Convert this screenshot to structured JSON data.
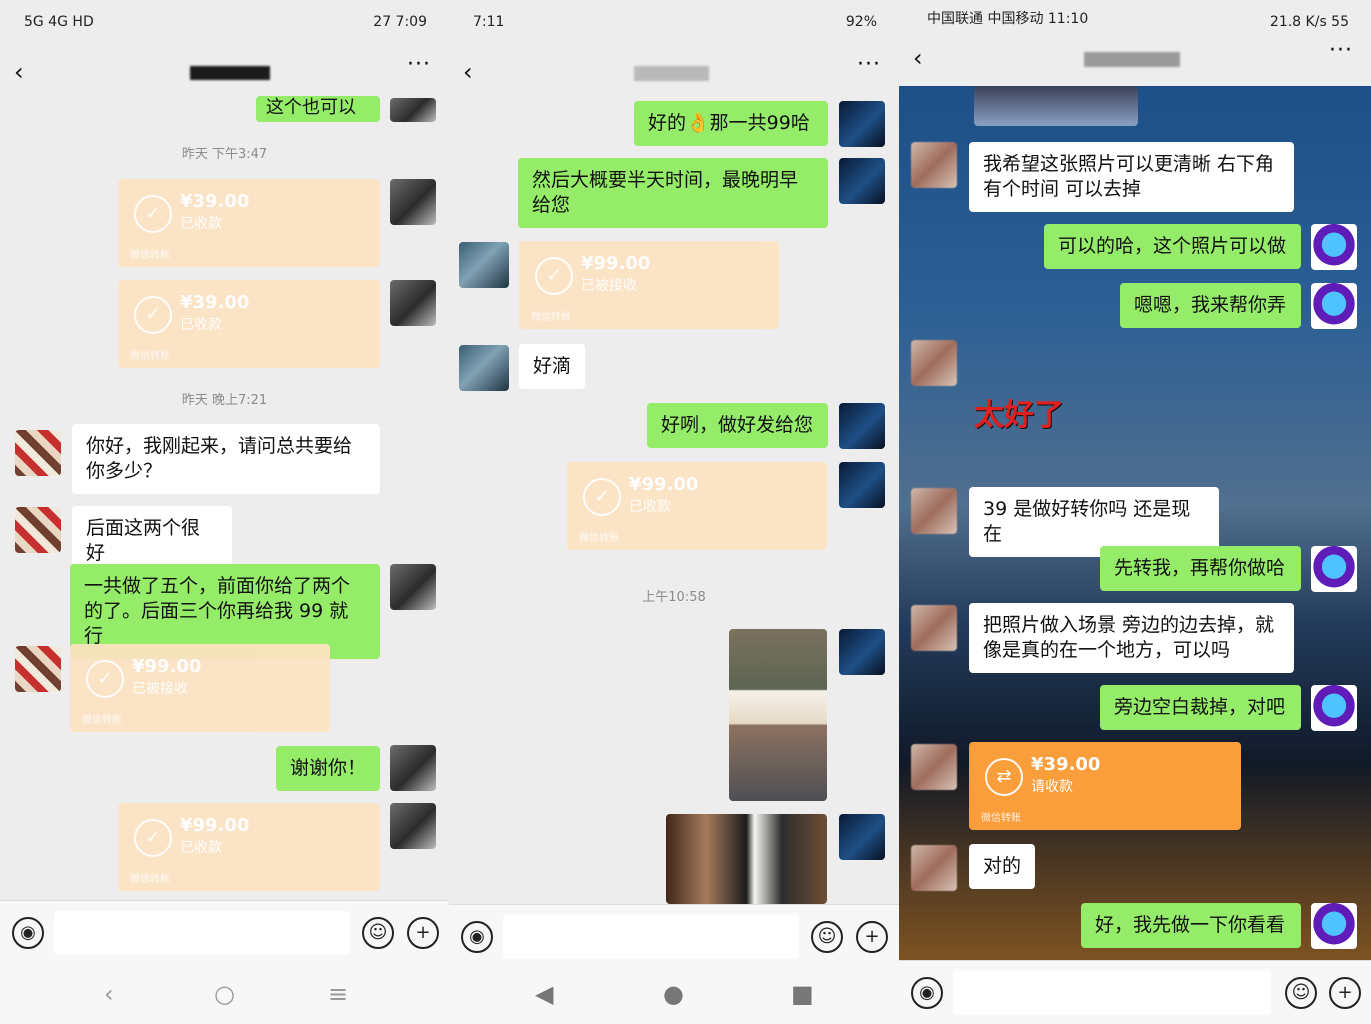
{
  "panels": {
    "p1": {
      "status": {
        "left": "5G 4G HD",
        "right": "27 7:09"
      },
      "timestamps": [
        "昨天 下午3:47",
        "昨天 晚上7:21"
      ],
      "top_partial_msg": "这个也可以",
      "payments": [
        {
          "amount": "¥39.00",
          "status": "已收款",
          "source": "微信转账"
        },
        {
          "amount": "¥39.00",
          "status": "已收款",
          "source": "微信转账"
        },
        {
          "amount": "¥99.00",
          "status": "已被接收",
          "source": "微信转账"
        },
        {
          "amount": "¥99.00",
          "status": "已收款",
          "source": "微信转账"
        }
      ],
      "messages": [
        {
          "text": "你好，我刚起来，请问总共要给你多少？",
          "side": "left"
        },
        {
          "text": "后面这两个很好",
          "side": "left"
        },
        {
          "text": "一共做了五个，前面你给了两个的了。后面三个你再给我 99 就行",
          "side": "right"
        },
        {
          "text": "谢谢你！",
          "side": "right"
        }
      ]
    },
    "p2": {
      "status": {
        "left": "7:11",
        "right": "92%"
      },
      "timestamps": [
        "上午10:58"
      ],
      "messages": [
        {
          "text": "好的👌那一共99哈",
          "side": "right"
        },
        {
          "text": "然后大概要半天时间，最晚明早给您",
          "side": "right"
        },
        {
          "text": "好滴",
          "side": "left"
        },
        {
          "text": "好咧，做好发给您",
          "side": "right"
        }
      ],
      "payments": [
        {
          "amount": "¥99.00",
          "status": "已被接收",
          "source": "微信转账"
        },
        {
          "amount": "¥99.00",
          "status": "已收款",
          "source": "微信转账"
        }
      ]
    },
    "p3": {
      "status": {
        "left": "中国联通 中国移动 11:10",
        "right": "21.8 K/s 55"
      },
      "messages": [
        {
          "text": "我希望这张照片可以更清晰 右下角有个时间 可以去掉",
          "side": "left"
        },
        {
          "text": "可以的哈，这个照片可以做",
          "side": "right"
        },
        {
          "text": "嗯嗯，我来帮你弄",
          "side": "right"
        },
        {
          "text": "39 是做好转你吗 还是现在",
          "side": "left"
        },
        {
          "text": "先转我，再帮你做哈",
          "side": "right"
        },
        {
          "text": "把照片做入场景 旁边的边去掉，就像是真的在一个地方，可以吗",
          "side": "left"
        },
        {
          "text": "旁边空白裁掉，对吧",
          "side": "right"
        },
        {
          "text": "对的",
          "side": "left"
        },
        {
          "text": "好，我先做一下你看看",
          "side": "right"
        }
      ],
      "sticker": "太好了",
      "payment": {
        "amount": "¥39.00",
        "status": "请收款",
        "source": "微信转账"
      }
    }
  },
  "icons": {
    "back": "chevron-left-icon",
    "more": "more-icon",
    "voice": "voice-icon",
    "emoji": "emoji-icon",
    "plus": "plus-icon"
  }
}
